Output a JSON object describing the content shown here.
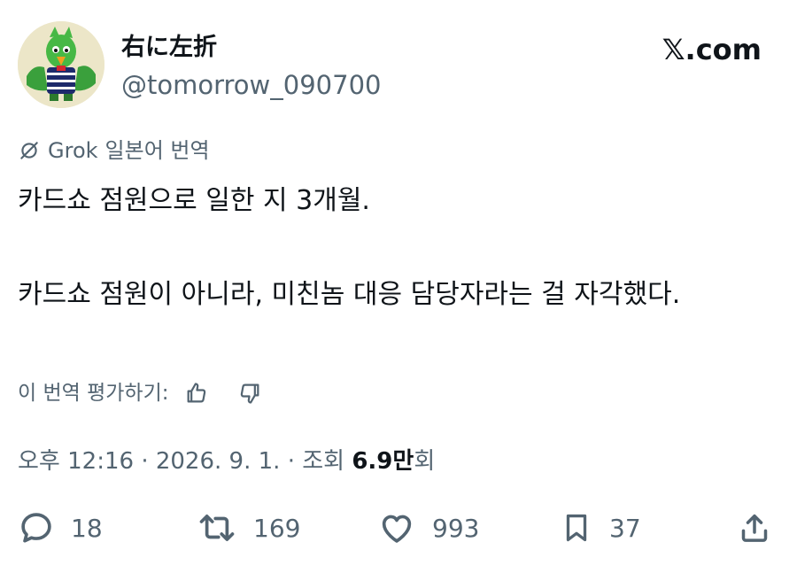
{
  "user": {
    "display_name": "右に左折",
    "handle": "@tomorrow_090700"
  },
  "brand": "𝕏.com",
  "translation": {
    "provider": "Grok",
    "note": "일본어 번역"
  },
  "tweet": {
    "text": "카드쇼 점원으로 일한 지 3개월.\n\n카드쇼 점원이 아니라, 미친놈 대응 담당자라는 걸 자각했다."
  },
  "rating": {
    "label": "이 번역 평가하기:"
  },
  "meta": {
    "time": "오후 12:16",
    "separator": "·",
    "date": "2026. 9. 1.",
    "views_label": "조회",
    "views_number": "6.9",
    "views_unit": "만",
    "views_suffix": "회"
  },
  "actions": {
    "replies": "18",
    "reposts": "169",
    "likes": "993",
    "bookmarks": "37"
  },
  "icons": {
    "avatar": "green-bird-mascot-avatar",
    "grok": "grok-icon",
    "thumbs_up": "thumbs-up-icon",
    "thumbs_down": "thumbs-down-icon",
    "reply": "reply-icon",
    "repost": "repost-icon",
    "like": "heart-icon",
    "bookmark": "bookmark-icon",
    "share": "share-icon"
  },
  "colors": {
    "text": "#0f1419",
    "secondary": "#536471",
    "background": "#ffffff"
  }
}
